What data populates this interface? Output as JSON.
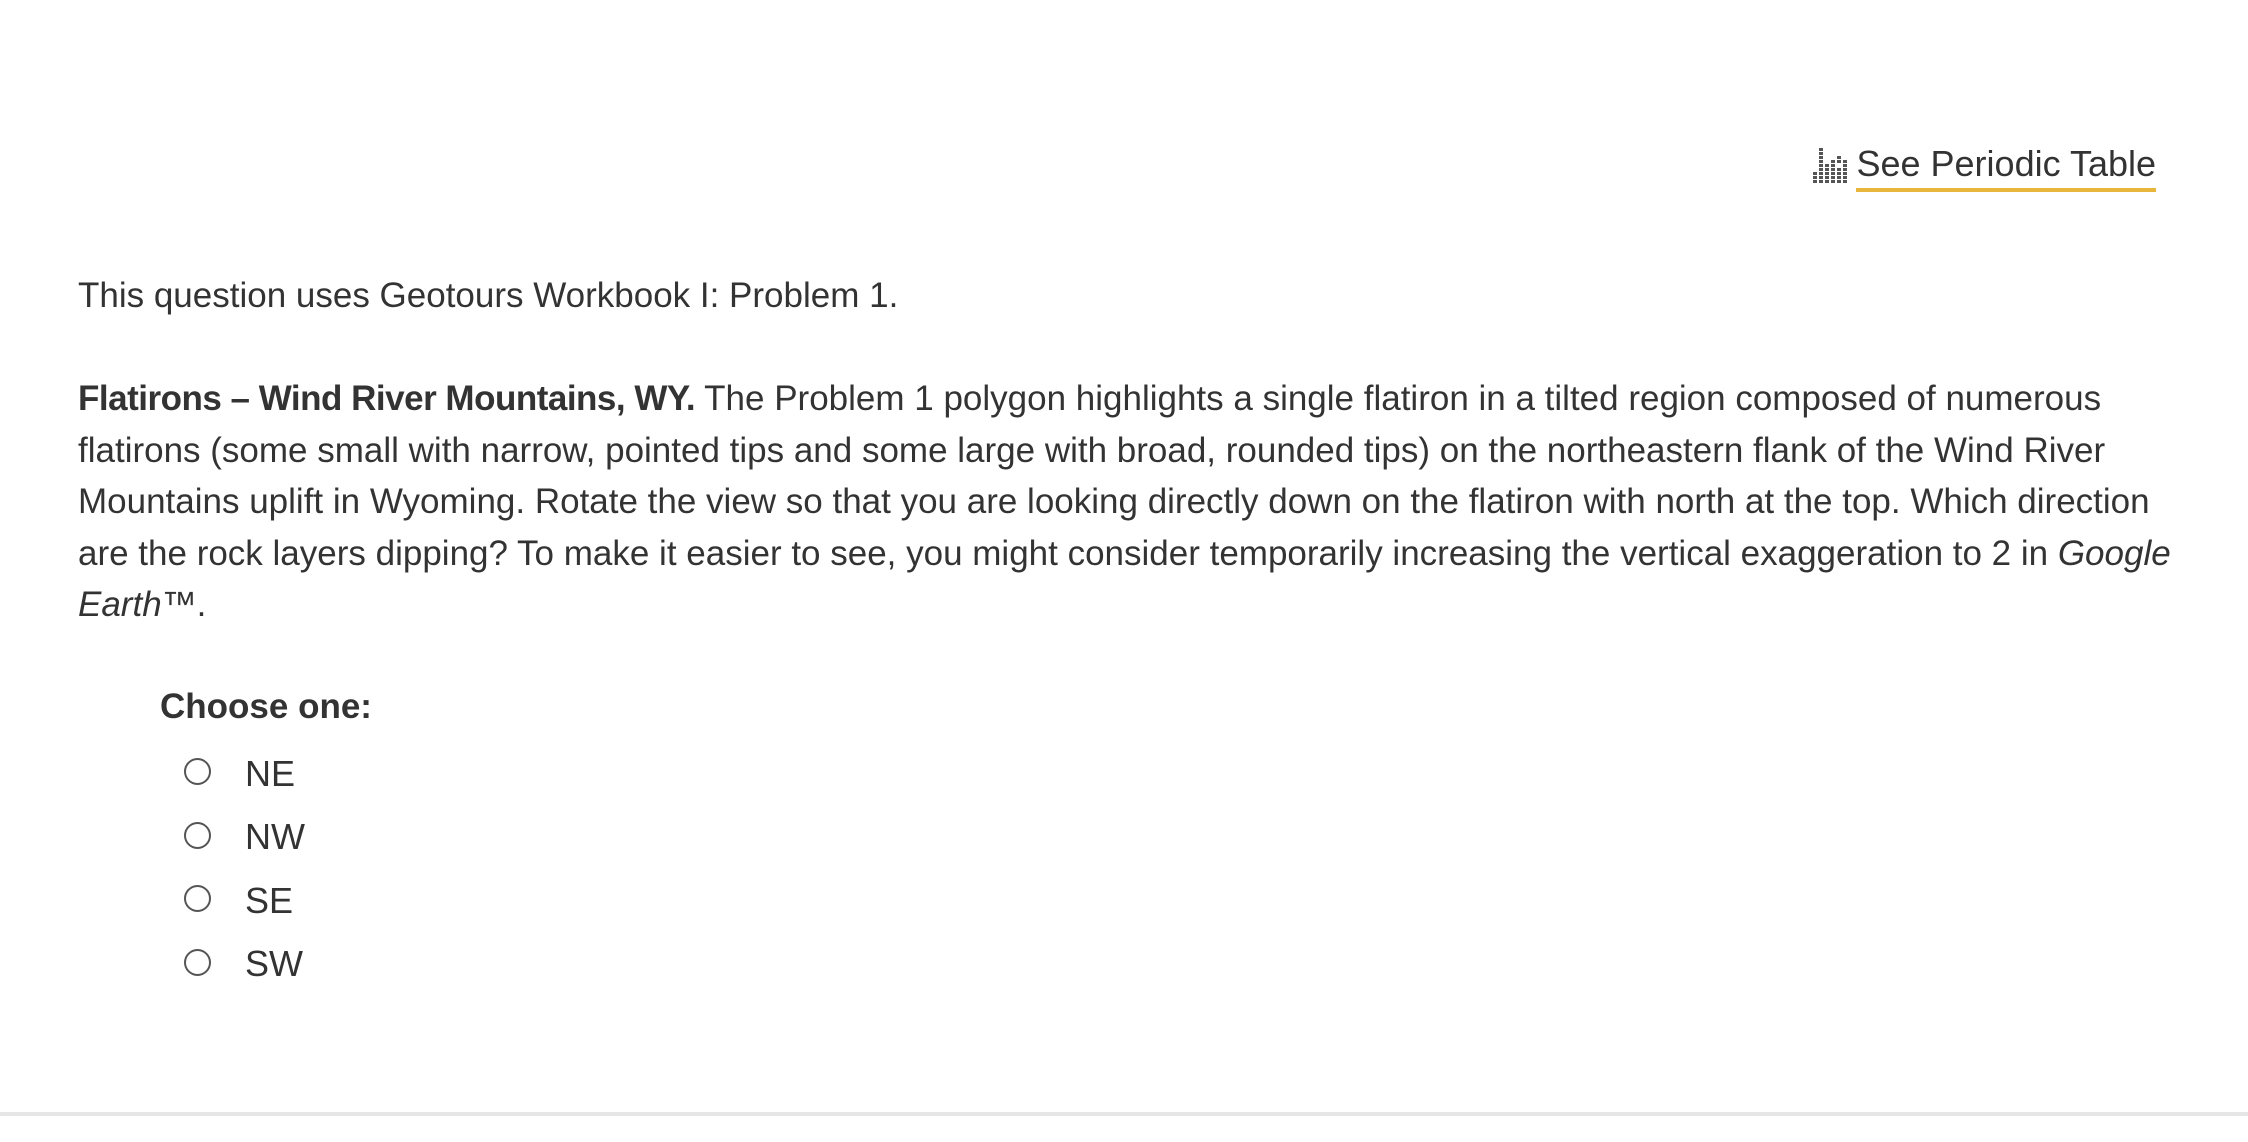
{
  "header": {
    "periodic_table_link": "See Periodic Table",
    "periodic_table_icon": "periodic-table-icon",
    "link_underline_color": "#e8b53d"
  },
  "question": {
    "intro": "This question uses Geotours Workbook I: Problem 1.",
    "lead": "Flatirons – Wind River Mountains, WY.",
    "body": " The Problem 1 polygon highlights a single flatiron in a tilted region composed of numerous flatirons (some small with narrow, pointed tips and some large with broad, rounded tips) on the northeastern flank of the Wind River Mountains uplift in Wyoming. Rotate the view so that you are looking directly down on the flatiron with north at the top. Which direction are the rock layers dipping? To make it easier to see, you might consider temporarily increasing the vertical exaggeration to 2 in ",
    "product": "Google Earth",
    "suffix": "™."
  },
  "choices": {
    "heading": "Choose one:",
    "options": [
      {
        "label": "NE",
        "selected": false
      },
      {
        "label": "NW",
        "selected": false
      },
      {
        "label": "SE",
        "selected": false
      },
      {
        "label": "SW",
        "selected": false
      }
    ]
  }
}
